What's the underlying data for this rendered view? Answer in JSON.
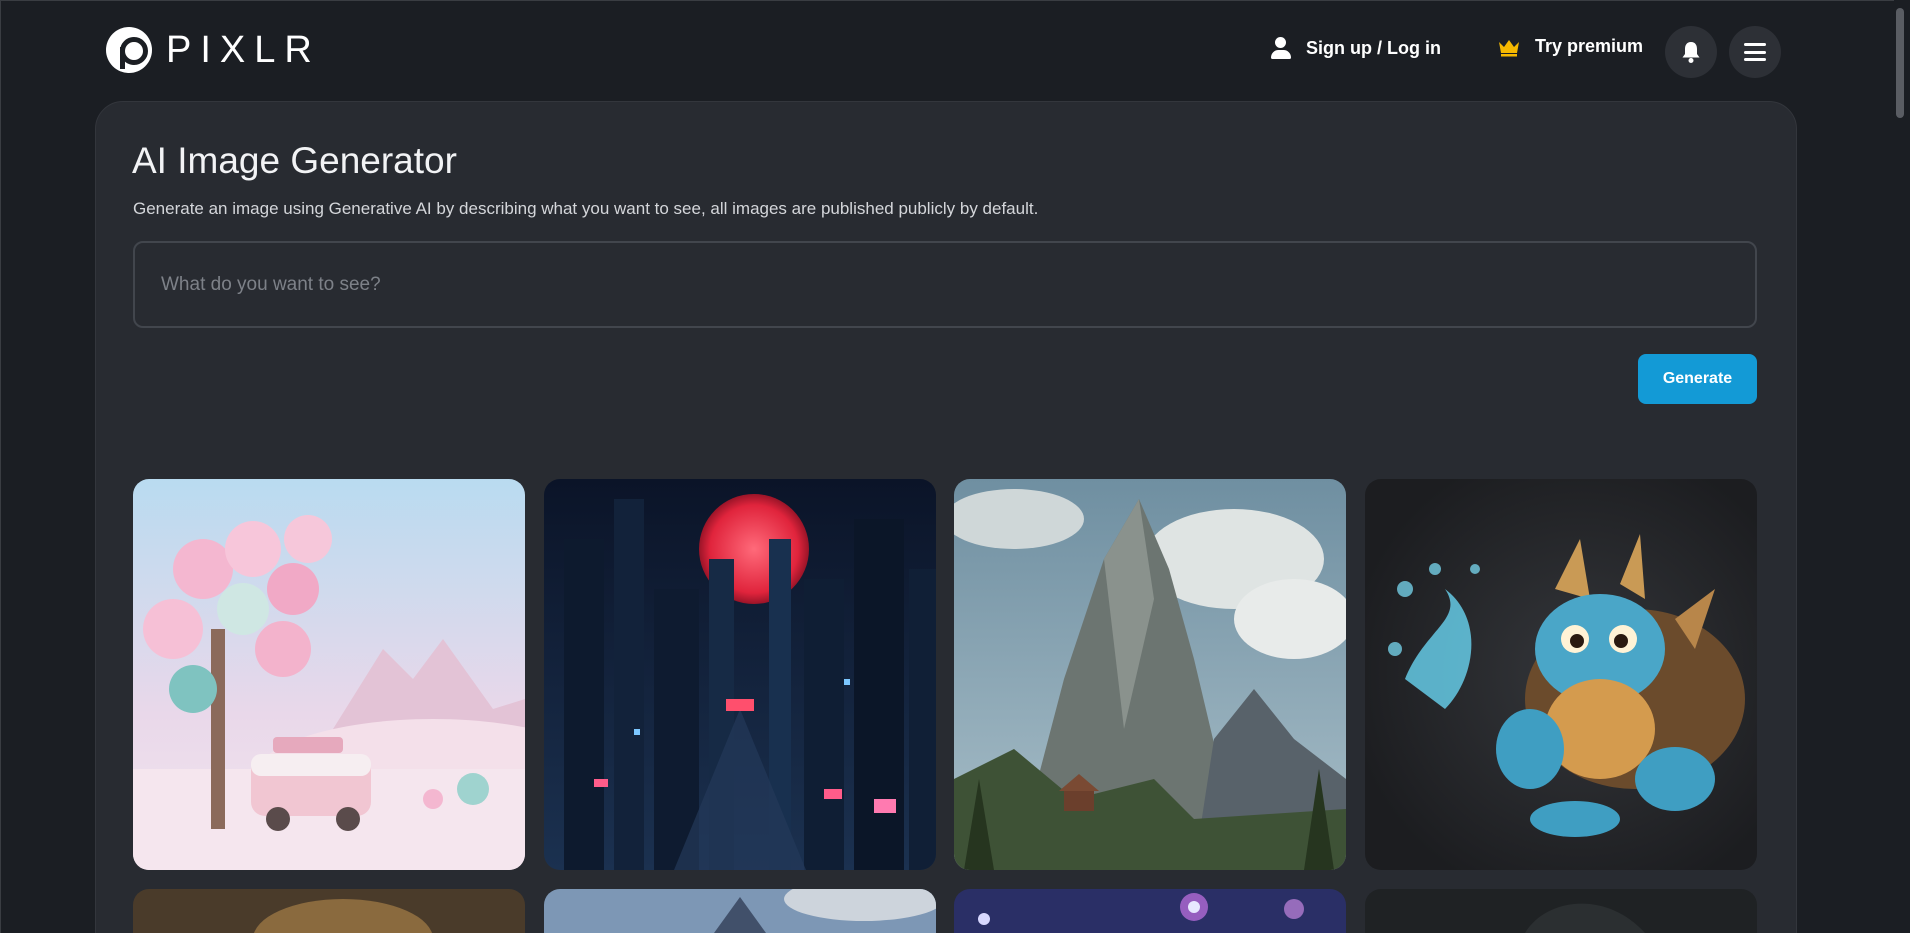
{
  "brand": {
    "name": "PIXLR"
  },
  "header": {
    "login_label": "Sign up / Log in",
    "premium_label": "Try premium",
    "icons": [
      "user-icon",
      "crown-icon",
      "bell-icon",
      "hamburger-menu-icon"
    ],
    "premium_color": "#f5b800"
  },
  "main": {
    "title": "AI Image Generator",
    "subtitle": "Generate an image using Generative AI by describing what you want to see, all images are published publicly by default.",
    "prompt": {
      "placeholder": "What do you want to see?",
      "value": ""
    },
    "generate_label": "Generate",
    "accent_color": "#139ad6"
  },
  "gallery": {
    "items": [
      {
        "subject": "pastel cotton-candy trees with pink camper van"
      },
      {
        "subject": "neon cyberpunk city under a red moon"
      },
      {
        "subject": "rocky mountain peak with cabin and pines"
      },
      {
        "subject": "blue turtle dragon creature holding water magic"
      },
      {
        "subject": "warm portrait (partially visible)"
      },
      {
        "subject": "mountain sky (partially visible)"
      },
      {
        "subject": "colorful bokeh lights (partially visible)"
      },
      {
        "subject": "dark scene (partially visible)"
      }
    ]
  }
}
